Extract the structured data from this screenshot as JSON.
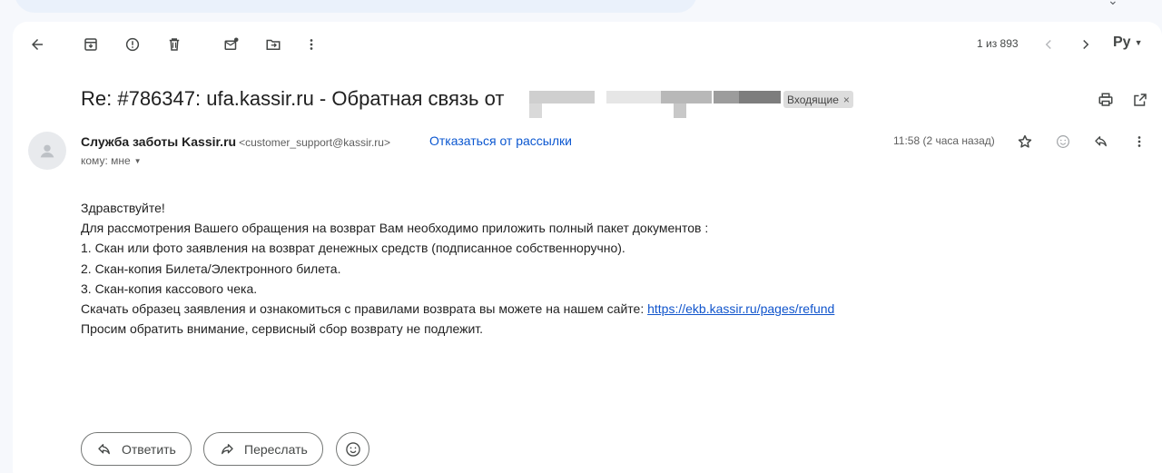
{
  "email": {
    "subject": "Re: #786347: ufa.kassir.ru - Обратная связь от",
    "label": "Входящие",
    "label_close": "×",
    "sender_name": "Служба заботы Kassir.ru",
    "sender_email": "<customer_support@kassir.ru>",
    "unsubscribe": "Отказаться от рассылки",
    "to": "кому: мне",
    "time": "11:58 (2 часа назад)",
    "body": {
      "greeting": "Здравствуйте!",
      "line1": "Для рассмотрения Вашего обращения на возврат Вам необходимо приложить полный пакет документов :",
      "line2": "1. Скан или фото заявления на возврат денежных средств (подписанное собственноручно).",
      "line3": "2. Скан-копия Билета/Электронного билета.",
      "line4": "3. Скан-копия кассового чека.",
      "line5_prefix": "Скачать образец заявления и ознакомиться с правилами возврата вы можете на нашем сайте: ",
      "link": "https://ekb.kassir.ru/pages/refund",
      "line6": "Просим обратить внимание, сервисный сбор возврату не подлежит."
    }
  },
  "toolbar": {
    "pager": "1 из 893",
    "lang": "Ру"
  },
  "actions": {
    "reply": "Ответить",
    "forward": "Переслать"
  },
  "icons": [
    "back-icon",
    "archive-icon",
    "report-spam-icon",
    "delete-icon",
    "mark-unread-icon",
    "move-to-icon",
    "more-vert-icon",
    "prev-icon",
    "next-icon",
    "print-icon",
    "open-new-window-icon",
    "star-icon",
    "emoji-icon",
    "reply-icon"
  ],
  "colors": {
    "link": "#1155cc",
    "unsubscribe": "#0b57d0",
    "card": "#ffffff",
    "background": "#f6f8fc"
  }
}
